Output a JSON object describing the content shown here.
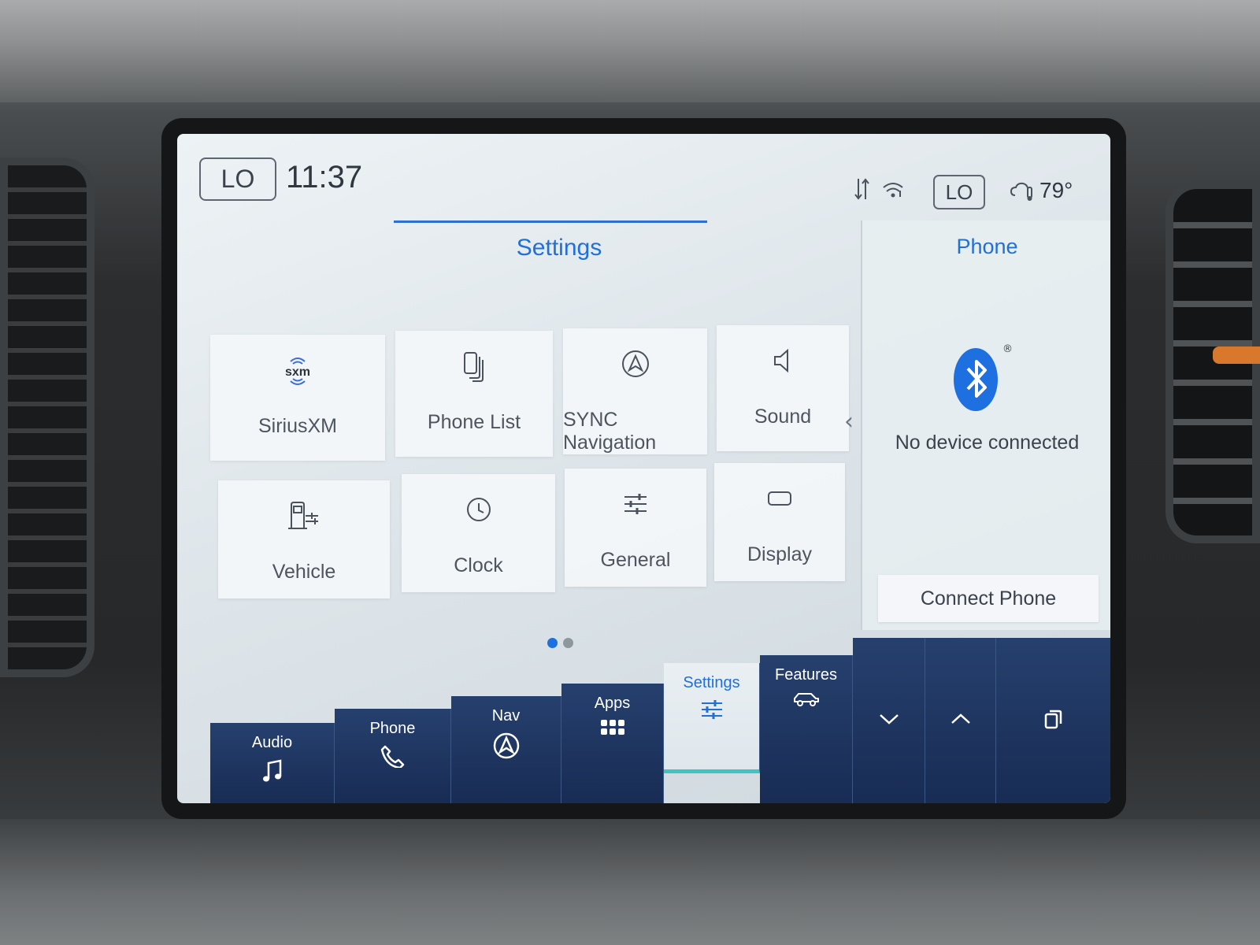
{
  "status_bar": {
    "left_climate": "LO",
    "time": "11:37",
    "right_climate": "LO",
    "temperature": "79°"
  },
  "settings_panel": {
    "title": "Settings",
    "tiles": [
      {
        "label": "SiriusXM",
        "icon": "siriusxm-logo",
        "logo_text": "sxm"
      },
      {
        "label": "Phone List",
        "icon": "phone-list-icon"
      },
      {
        "label": "SYNC Navigation",
        "icon": "navigation-icon"
      },
      {
        "label": "Sound",
        "icon": "speaker-icon"
      },
      {
        "label": "Vehicle",
        "icon": "vehicle-icon"
      },
      {
        "label": "Clock",
        "icon": "clock-icon"
      },
      {
        "label": "General",
        "icon": "sliders-icon"
      },
      {
        "label": "Display",
        "icon": "display-icon"
      }
    ],
    "page_count": 2,
    "current_page": 1
  },
  "phone_panel": {
    "title": "Phone",
    "status": "No device connected",
    "connect_label": "Connect Phone",
    "accent_color": "#1e6fe0"
  },
  "bottom_nav": {
    "items": [
      {
        "label": "Audio",
        "icon": "music-note-icon"
      },
      {
        "label": "Phone",
        "icon": "phone-icon"
      },
      {
        "label": "Nav",
        "icon": "navigation-icon"
      },
      {
        "label": "Apps",
        "icon": "apps-grid-icon"
      },
      {
        "label": "Settings",
        "icon": "settings-sliders-icon",
        "active": true
      },
      {
        "label": "Features",
        "icon": "car-features-icon"
      }
    ],
    "controls": [
      "chevron-down-icon",
      "chevron-up-icon",
      "copy-windows-icon"
    ]
  },
  "colors": {
    "accent_blue": "#2170d8",
    "nav_background": "#1e3560",
    "active_indicator": "#3fc4c4"
  }
}
